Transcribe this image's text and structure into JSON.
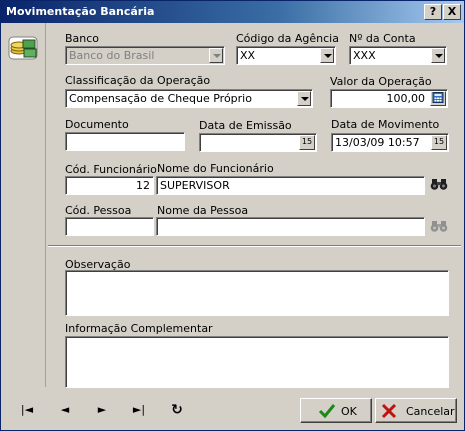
{
  "window": {
    "title": "Movimentação Bancária",
    "help_label": "?",
    "close_label": "X"
  },
  "labels": {
    "banco": "Banco",
    "codigo_agencia": "Código da Agência",
    "num_conta": "Nº da Conta",
    "classificacao": "Classificação da Operação",
    "valor": "Valor da Operação",
    "documento": "Documento",
    "data_emissao": "Data de Emissão",
    "data_movimento": "Data de Movimento",
    "cod_funcionario": "Cód. Funcionário",
    "nome_funcionario": "Nome do Funcionário",
    "cod_pessoa": "Cód. Pessoa",
    "nome_pessoa": "Nome da Pessoa",
    "observacao": "Observação",
    "info_complementar": "Informação Complementar"
  },
  "values": {
    "banco": "Banco do Brasil",
    "codigo_agencia": "XX",
    "num_conta": "XXX",
    "classificacao": "Compensação de Cheque Próprio",
    "valor": "100,00",
    "documento": "",
    "data_emissao": "",
    "data_movimento": "13/03/09 10:57",
    "cod_funcionario": "12",
    "nome_funcionario": "SUPERVISOR",
    "cod_pessoa": "",
    "nome_pessoa": "",
    "observacao": "",
    "info_complementar": ""
  },
  "calendar_label": "15",
  "nav": {
    "first": "|◄",
    "prev": "◄",
    "next": "►",
    "last": "►|",
    "refresh": "↻"
  },
  "buttons": {
    "ok": "OK",
    "cancel": "Cancelar"
  },
  "icons": {
    "app": "money-stack-icon",
    "search": "binoculars-icon",
    "ok": "check-icon",
    "cancel": "x-icon"
  },
  "colors": {
    "title_start": "#0a246a",
    "title_end": "#a6caf0",
    "ok_check": "#1a8a1a",
    "cancel_x": "#c01010",
    "face": "#d4d0c8"
  }
}
